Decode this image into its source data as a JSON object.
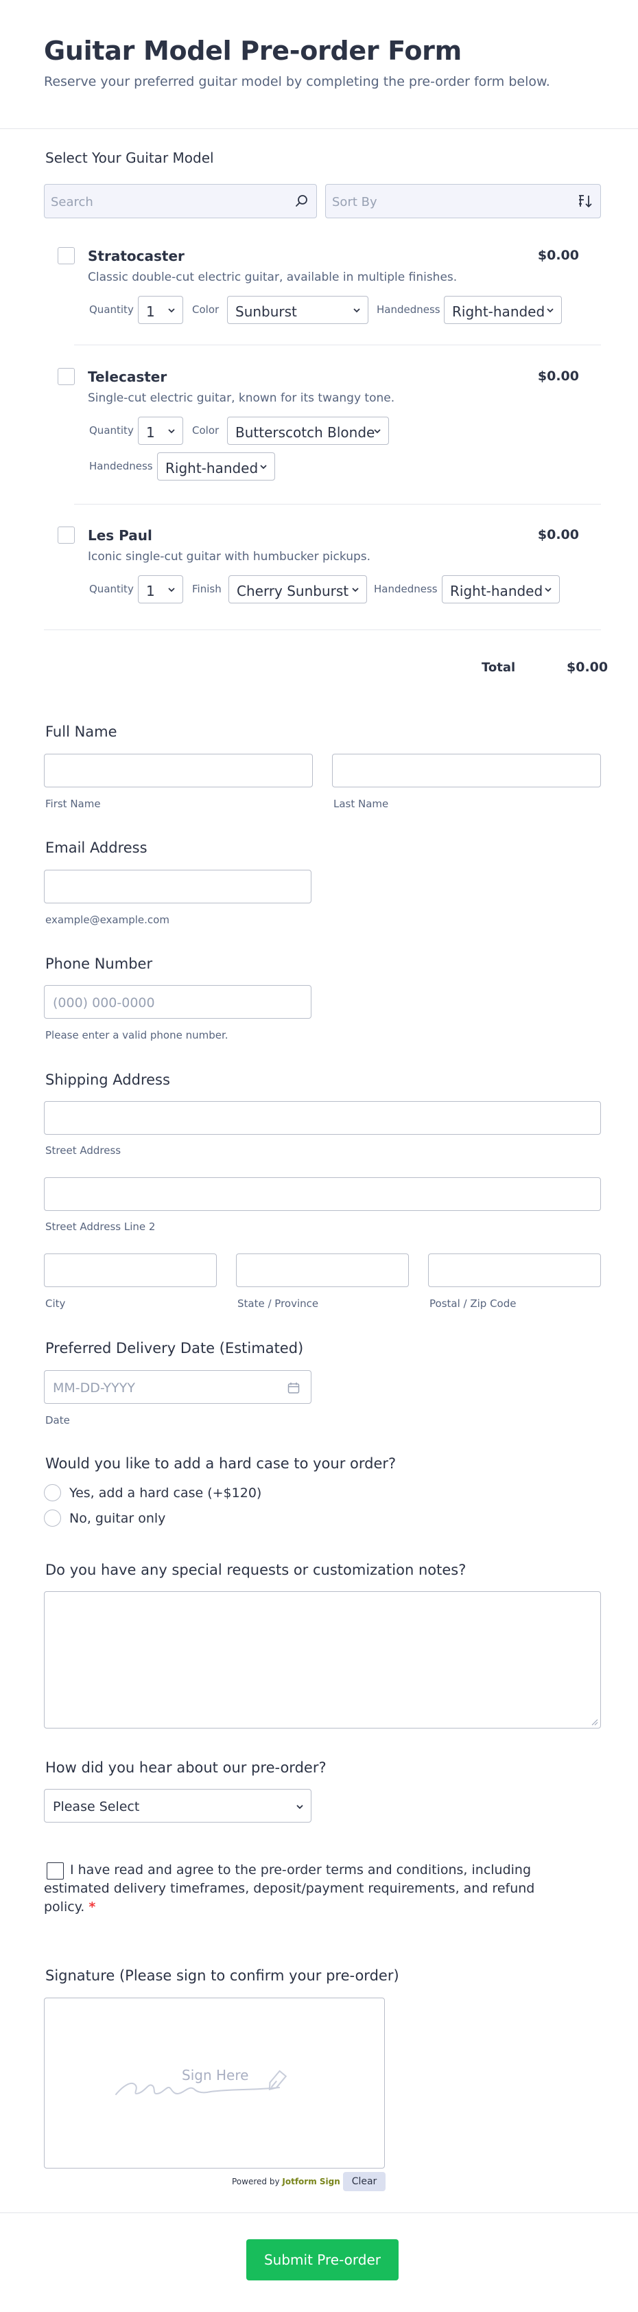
{
  "header": {
    "title": "Guitar Model Pre-order Form",
    "subtitle": "Reserve your preferred guitar model by completing the pre-order form below."
  },
  "products_section": {
    "label": "Select Your Guitar Model",
    "search_placeholder": "Search",
    "sort_placeholder": "Sort By",
    "products": [
      {
        "name": "Stratocaster",
        "price": "$0.00",
        "description": "Classic double-cut electric guitar, available in multiple finishes.",
        "options": [
          {
            "label": "Quantity",
            "value": "1"
          },
          {
            "label": "Color",
            "value": "Sunburst"
          },
          {
            "label": "Handedness",
            "value": "Right-handed"
          }
        ]
      },
      {
        "name": "Telecaster",
        "price": "$0.00",
        "description": "Single-cut electric guitar, known for its twangy tone.",
        "options": [
          {
            "label": "Quantity",
            "value": "1"
          },
          {
            "label": "Color",
            "value": "Butterscotch Blonde"
          },
          {
            "label": "Handedness",
            "value": "Right-handed"
          }
        ]
      },
      {
        "name": "Les Paul",
        "price": "$0.00",
        "description": "Iconic single-cut guitar with humbucker pickups.",
        "options": [
          {
            "label": "Quantity",
            "value": "1"
          },
          {
            "label": "Finish",
            "value": "Cherry Sunburst"
          },
          {
            "label": "Handedness",
            "value": "Right-handed"
          }
        ]
      }
    ],
    "total_label": "Total",
    "total_value": "$0.00"
  },
  "full_name": {
    "label": "Full Name",
    "first_sublabel": "First Name",
    "last_sublabel": "Last Name"
  },
  "email": {
    "label": "Email Address",
    "sublabel": "example@example.com"
  },
  "phone": {
    "label": "Phone Number",
    "placeholder": "(000) 000-0000",
    "sublabel": "Please enter a valid phone number."
  },
  "address": {
    "label": "Shipping Address",
    "street_sublabel": "Street Address",
    "street2_sublabel": "Street Address Line 2",
    "city_sublabel": "City",
    "state_sublabel": "State / Province",
    "zip_sublabel": "Postal / Zip Code"
  },
  "delivery_date": {
    "label": "Preferred Delivery Date (Estimated)",
    "placeholder": "MM-DD-YYYY",
    "sublabel": "Date"
  },
  "hard_case": {
    "label": "Would you like to add a hard case to your order?",
    "options": [
      "Yes, add a hard case (+$120)",
      "No, guitar only"
    ]
  },
  "special_requests": {
    "label": "Do you have any special requests or customization notes?"
  },
  "referral": {
    "label": "How did you hear about our pre-order?",
    "selected": "Please Select"
  },
  "terms": {
    "text": "I have read and agree to the pre-order terms and conditions, including estimated delivery timeframes, deposit/payment requirements, and refund policy.",
    "required_mark": "*"
  },
  "signature": {
    "label": "Signature (Please sign to confirm your pre-order)",
    "placeholder": "Sign Here",
    "powered_prefix": "Powered by",
    "powered_brand": "Jotform Sign",
    "clear_label": "Clear"
  },
  "submit": {
    "label": "Submit Pre-order"
  },
  "colors": {
    "accent_green": "#18bd5b",
    "text_primary": "#2c3345",
    "text_secondary": "#57647e",
    "border": "#b8bdc9",
    "required_red": "#f23a3c",
    "toolbar_bg": "#f3f4fb"
  }
}
